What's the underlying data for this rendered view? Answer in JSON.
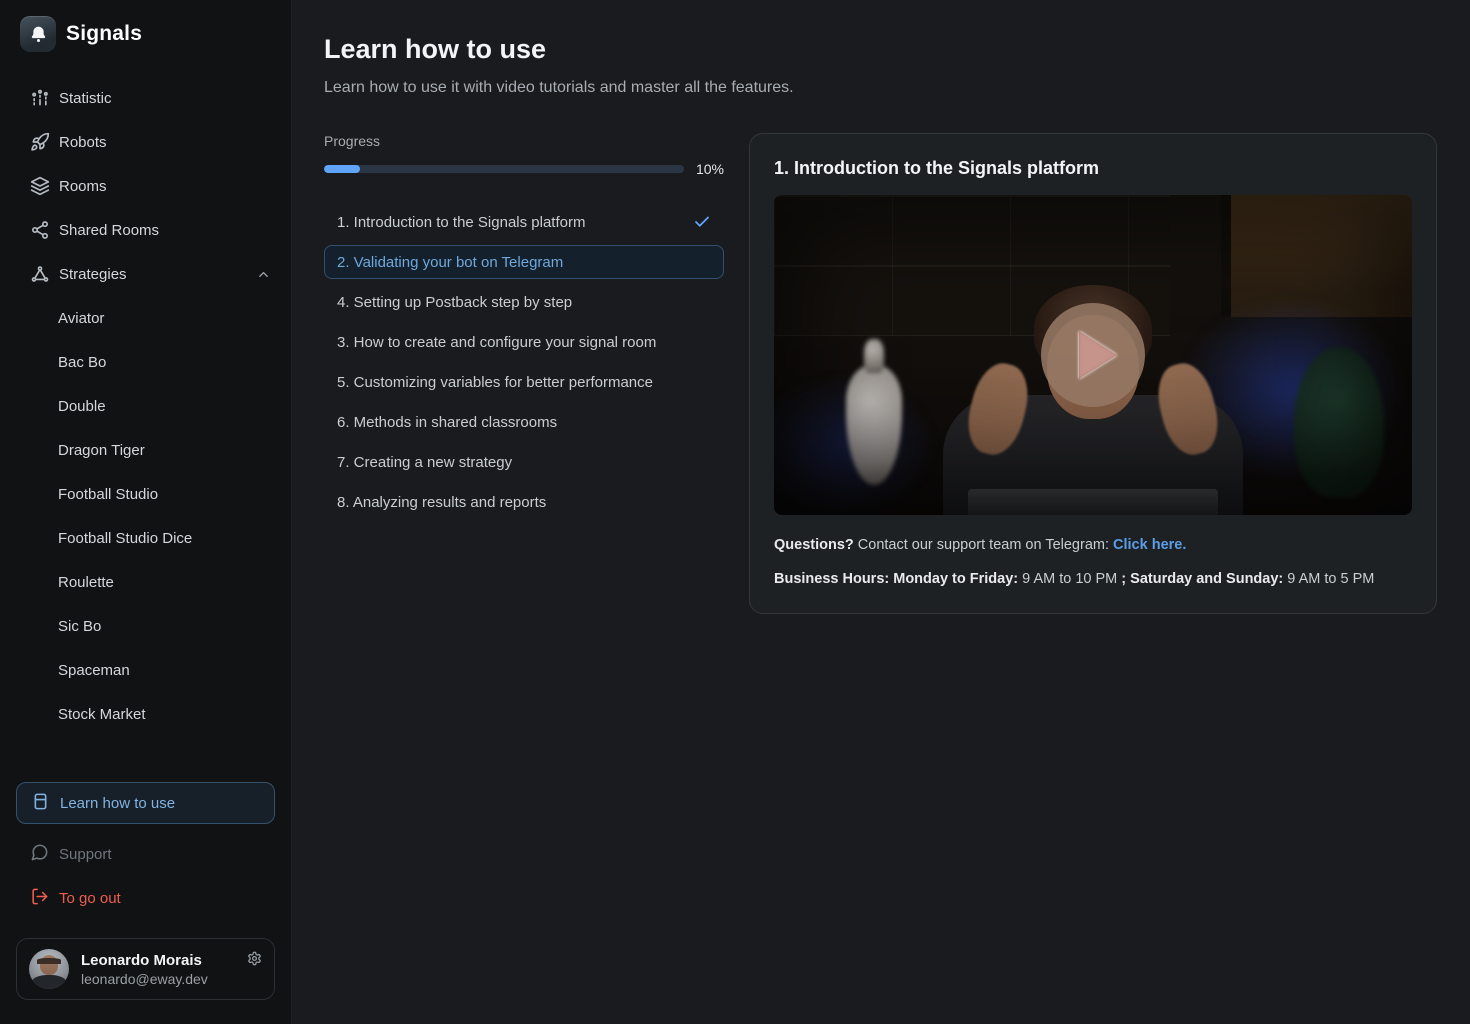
{
  "app": {
    "name": "Signals"
  },
  "colors": {
    "accent_blue": "#60a5fa",
    "active_text_blue": "#6ea8dc",
    "danger_red": "#ee5d4f",
    "sidebar_bg": "#101214",
    "main_bg": "#191b1e",
    "card_bg": "#1e2124"
  },
  "sidebar": {
    "logo": {
      "label": "Signals",
      "icon": "bell-icon"
    },
    "nav": [
      {
        "label": "Statistic",
        "icon": "chart-icon"
      },
      {
        "label": "Robots",
        "icon": "rocket-icon"
      },
      {
        "label": "Rooms",
        "icon": "layers-icon"
      },
      {
        "label": "Shared Rooms",
        "icon": "share-icon"
      },
      {
        "label": "Strategies",
        "icon": "strategy-icon",
        "expanded": true
      }
    ],
    "strategies": [
      {
        "label": "Aviator"
      },
      {
        "label": "Bac Bo"
      },
      {
        "label": "Double"
      },
      {
        "label": "Dragon Tiger"
      },
      {
        "label": "Football Studio"
      },
      {
        "label": "Football Studio Dice"
      },
      {
        "label": "Roulette"
      },
      {
        "label": "Sic Bo"
      },
      {
        "label": "Spaceman"
      },
      {
        "label": "Stock Market"
      }
    ],
    "footer": [
      {
        "label": "Learn how to use",
        "icon": "book-icon",
        "state": "active"
      },
      {
        "label": "Support",
        "icon": "support-chat-icon",
        "state": "muted"
      },
      {
        "label": "To go out",
        "icon": "logout-icon",
        "state": "danger"
      }
    ],
    "user": {
      "name": "Leonardo Morais",
      "email": "leonardo@eway.dev"
    }
  },
  "main": {
    "title": "Learn how to use",
    "subtitle": "Learn how to use it with video tutorials and master all the features.",
    "progress": {
      "label": "Progress",
      "percent": 10,
      "percent_label": "10%",
      "bar_style": "width:10%"
    },
    "lessons": [
      {
        "label": "1. Introduction to the Signals platform",
        "state": "completed"
      },
      {
        "label": "2. Validating your bot on Telegram",
        "state": "active"
      },
      {
        "label": "4. Setting up Postback step by step",
        "state": "default"
      },
      {
        "label": "3. How to create and configure your signal room",
        "state": "default"
      },
      {
        "label": "5. Customizing variables for better performance",
        "state": "default"
      },
      {
        "label": "6. Methods in shared classrooms",
        "state": "default"
      },
      {
        "label": "7. Creating a new strategy",
        "state": "default"
      },
      {
        "label": "8. Analyzing results and reports",
        "state": "default"
      }
    ],
    "detail": {
      "title": "1. Introduction to the Signals platform",
      "questions_bold": "Questions?",
      "questions_text": " Contact our support team on Telegram: ",
      "questions_link": "Click here.",
      "hours_bold1": "Business Hours: Monday to Friday: ",
      "hours_text1": "9 AM to 10 PM ",
      "hours_bold2": "; Saturday and Sunday: ",
      "hours_text2": "9 AM to 5 PM"
    }
  }
}
